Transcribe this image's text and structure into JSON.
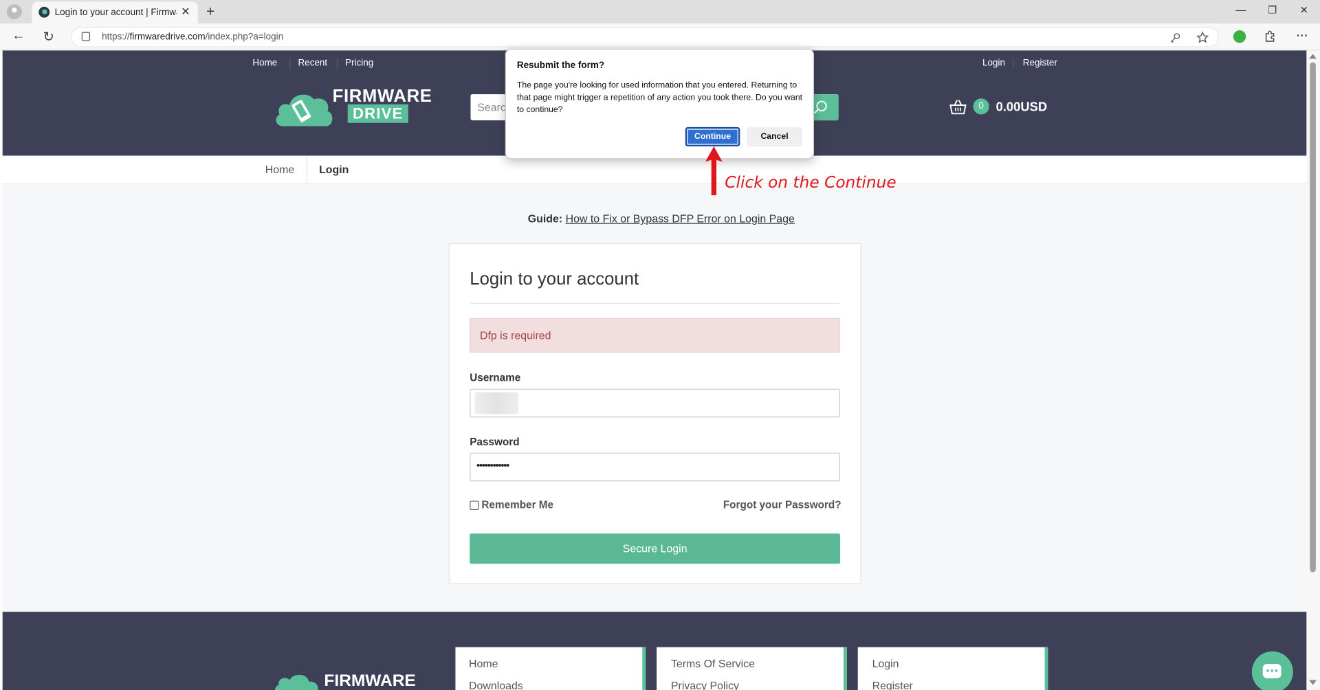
{
  "browser": {
    "tab_title": "Login to your account | Firmware",
    "tab_close": "✕",
    "new_tab": "+",
    "url_prefix": "https://",
    "url_host": "firmwaredrive.com",
    "url_path": "/index.php?a=login",
    "minimize": "—",
    "restore": "❐",
    "close": "✕",
    "back": "←",
    "reload": "↻",
    "more": "···",
    "icons": [
      "back-icon",
      "reload-icon",
      "lock-icon",
      "key-icon",
      "star-icon",
      "extension-icon",
      "puzzle-icon",
      "more-icon"
    ]
  },
  "site": {
    "top_links_left": [
      "Home",
      "Recent",
      "Pricing"
    ],
    "top_links_right": [
      "Login",
      "Register"
    ],
    "logo_line1": "FIRMWARE",
    "logo_line2": "DRIVE",
    "search_placeholder": "Search",
    "cart_count": "0",
    "cart_total": "0.00USD",
    "brand_color": "#5bbf9a",
    "header_color": "#3d4057"
  },
  "breadcrumb": {
    "home": "Home",
    "current": "Login"
  },
  "guide": {
    "label": "Guide:",
    "link": "How to Fix or Bypass DFP Error on Login Page"
  },
  "login": {
    "title": "Login to your account",
    "alert": "Dfp is required",
    "username_label": "Username",
    "username_value": "",
    "password_label": "Password",
    "password_value": "••••••••••••",
    "remember": "Remember Me",
    "remember_checked": false,
    "forgot": "Forgot your Password?",
    "submit": "Secure Login"
  },
  "footer": {
    "logo": "FIRMWARE",
    "col1": [
      "Home",
      "Downloads"
    ],
    "col2": [
      "Terms Of Service",
      "Privacy Policy"
    ],
    "col3": [
      "Login",
      "Register"
    ]
  },
  "dialog": {
    "title": "Resubmit the form?",
    "message": "The page you're looking for used information that you entered. Returning to that page might trigger a repetition of any action you took there. Do you want to continue?",
    "continue": "Continue",
    "cancel": "Cancel"
  },
  "annotation": {
    "text": "Click on the Continue",
    "color": "#e0161c"
  }
}
